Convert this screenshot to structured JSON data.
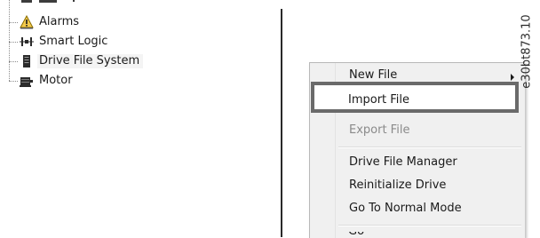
{
  "tree": {
    "items": [
      {
        "label": "Alarms",
        "icon": "warning-icon"
      },
      {
        "label": "Smart Logic",
        "icon": "logic-icon"
      },
      {
        "label": "Drive File System",
        "icon": "file-system-icon"
      },
      {
        "label": "Motor",
        "icon": "motor-icon"
      }
    ]
  },
  "context_menu": {
    "items": [
      {
        "label": "New File",
        "has_submenu": true,
        "disabled": false
      },
      {
        "label": "Import File",
        "has_submenu": false,
        "disabled": false,
        "highlighted": true
      },
      {
        "label": "Export File",
        "has_submenu": false,
        "disabled": true
      },
      {
        "label": "Drive File Manager",
        "has_submenu": false,
        "disabled": false
      },
      {
        "label": "Reinitialize Drive",
        "has_submenu": false,
        "disabled": false
      },
      {
        "label": "Go To Normal Mode",
        "has_submenu": false,
        "disabled": false
      },
      {
        "label": "Go",
        "has_submenu": false,
        "disabled": false,
        "cut_off": true
      }
    ]
  },
  "figure_id": "e30bt873.10",
  "colors": {
    "menu_background": "#f0f0f0",
    "highlight_border": "#6a6a6a",
    "disabled_text": "#8a8a8a"
  }
}
